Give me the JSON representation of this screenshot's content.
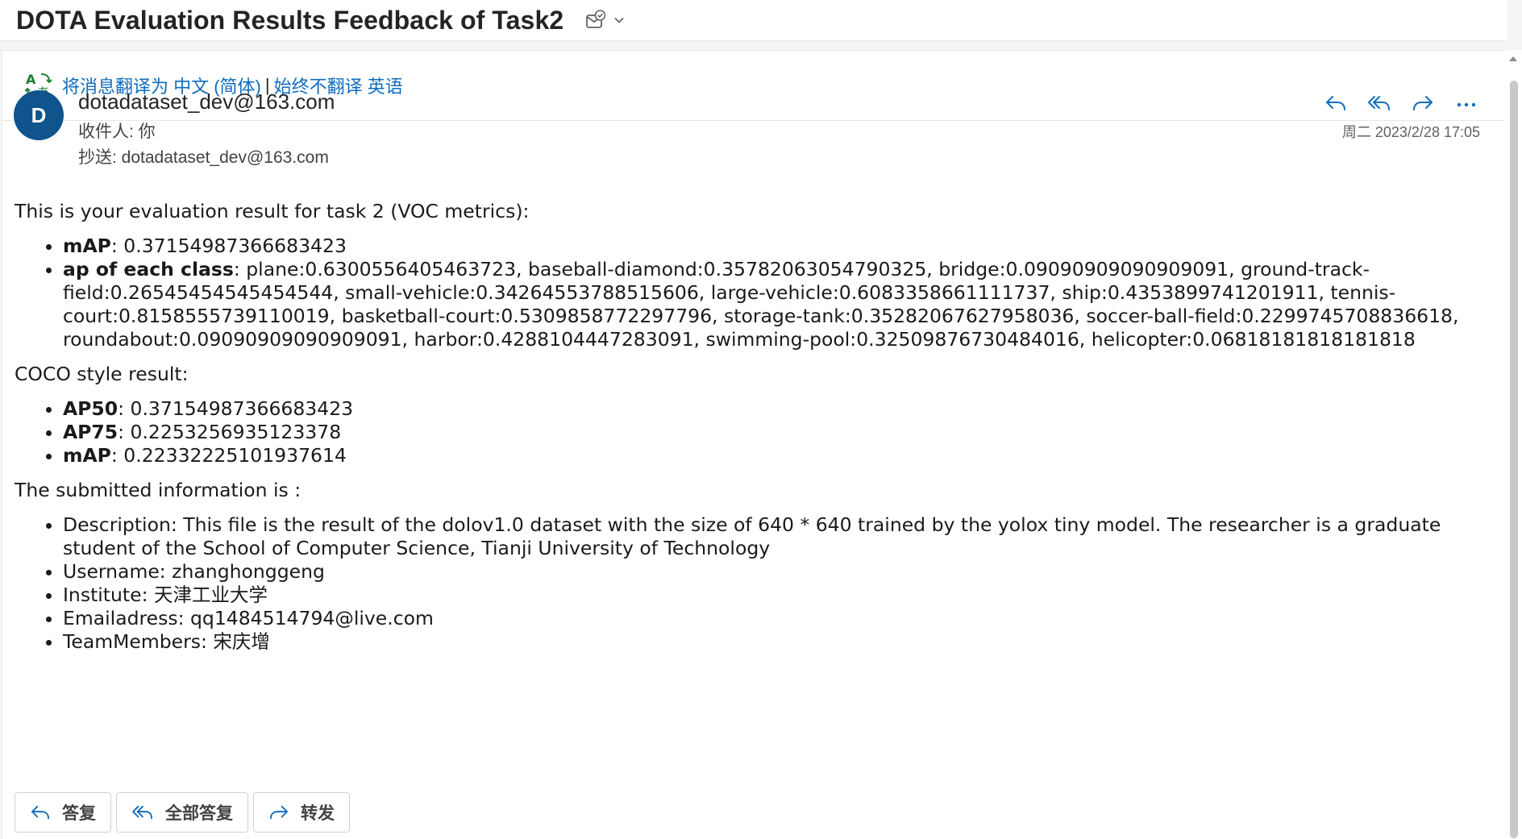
{
  "subject": {
    "title": "DOTA Evaluation Results Feedback of Task2"
  },
  "icons": {
    "subject_action": "checklist-mail-icon",
    "subject_dropdown": "chevron-down-icon",
    "translate": "translate-icon",
    "reply": "reply-icon",
    "reply_all": "reply-all-icon",
    "forward": "forward-icon",
    "more": "more-icon"
  },
  "translate": {
    "translate_link": "将消息翻译为 中文 (简体)",
    "separator": "|",
    "never_link": "始终不翻译 英语"
  },
  "header": {
    "avatar_initial": "D",
    "sender": "dotadataset_dev@163.com",
    "to": "收件人:  你",
    "cc": "抄送:  dotadataset_dev@163.com",
    "date": "周二 2023/2/28 17:05"
  },
  "body": {
    "intro": "This is your evaluation result for task 2 (VOC metrics):",
    "voc": [
      {
        "label": "mAP",
        "value": ": 0.37154987366683423"
      },
      {
        "label": "ap of each class",
        "value": ": plane:0.6300556405463723, baseball-diamond:0.35782063054790325, bridge:0.09090909090909091, ground-track-field:0.26545454545454544, small-vehicle:0.34264553788515606, large-vehicle:0.6083358661111737, ship:0.4353899741201911, tennis-court:0.8158555739110019, basketball-court:0.5309858772297796, storage-tank:0.35282067627958036, soccer-ball-field:0.2299745708836618, roundabout:0.09090909090909091, harbor:0.4288104447283091, swimming-pool:0.32509876730484016, helicopter:0.06818181818181818"
      }
    ],
    "coco_intro": "COCO style result:",
    "coco": [
      {
        "label": "AP50",
        "value": ": 0.37154987366683423"
      },
      {
        "label": "AP75",
        "value": ": 0.2253256935123378"
      },
      {
        "label": "mAP",
        "value": ": 0.22332225101937614"
      }
    ],
    "submitted_intro": "The submitted information is :",
    "submitted": [
      "Description: This file is the result of the dolov1.0 dataset with the size of 640 * 640 trained by the yolox tiny model. The researcher is a graduate student of the School of Computer Science, Tianji University of Technology",
      "Username: zhanghonggeng",
      "Institute: 天津工业大学",
      "Emailadress: qq1484514794@live.com",
      "TeamMembers: 宋庆增"
    ]
  },
  "actions": {
    "reply": "答复",
    "reply_all": "全部答复",
    "forward": "转发"
  },
  "colors": {
    "accent": "#0f6cbd",
    "avatar_bg": "#0f548c",
    "translate_green": "#1a7f37"
  }
}
